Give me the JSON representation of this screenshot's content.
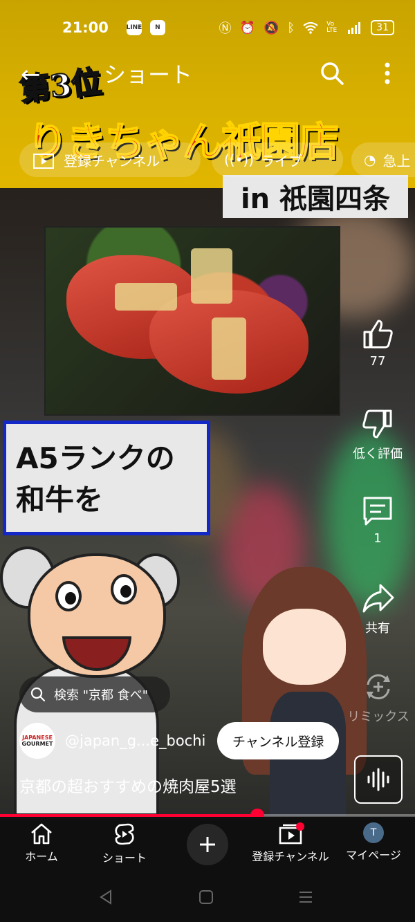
{
  "status_bar": {
    "time": "21:00",
    "app_icons": [
      "line-icon",
      "news-icon"
    ],
    "battery": "31",
    "indicators": [
      "nfc-icon",
      "alarm-icon",
      "mute-icon",
      "bluetooth-icon",
      "wifi-icon",
      "volte-icon",
      "signal-icon"
    ],
    "volte_label": "Vo LTE"
  },
  "header": {
    "title": "ショート"
  },
  "chips": [
    {
      "label": "登録チャンネル",
      "icon": "subscriptions-icon"
    },
    {
      "label": "ライブ",
      "icon": "live-icon"
    },
    {
      "label": "急上",
      "icon": "trending-icon"
    }
  ],
  "video_overlay": {
    "badge": "第3位",
    "shop_name": "りきちゃん祇園店",
    "location": "in 祇園四条",
    "caption_line1": "A5ランクの",
    "caption_line2": "和牛を"
  },
  "actions": {
    "like_count": "77",
    "dislike_label": "低く評価",
    "comment_count": "1",
    "share_label": "共有",
    "remix_label": "リミックス"
  },
  "search_suggestion": "検索 \"京都 食べ\"",
  "channel": {
    "avatar_text_1": "JAPANESE",
    "avatar_text_2": "GOURMET",
    "handle": "@japan_g...e_bochi",
    "subscribe_label": "チャンネル登録"
  },
  "video_title": "京都の超おすすめの焼肉屋5選",
  "progress": {
    "fraction": 0.62
  },
  "bottom_nav": [
    {
      "label": "ホーム",
      "icon": "home-icon"
    },
    {
      "label": "ショート",
      "icon": "shorts-icon"
    },
    {
      "label": "",
      "icon": "create-icon"
    },
    {
      "label": "登録チャンネル",
      "icon": "subscriptions-icon"
    },
    {
      "label": "マイページ",
      "icon": "avatar"
    }
  ],
  "my_avatar_letter": "T",
  "colors": {
    "accent": "#ff0033",
    "banner_yellow": "#d9b100",
    "caption_border": "#1428c8"
  }
}
